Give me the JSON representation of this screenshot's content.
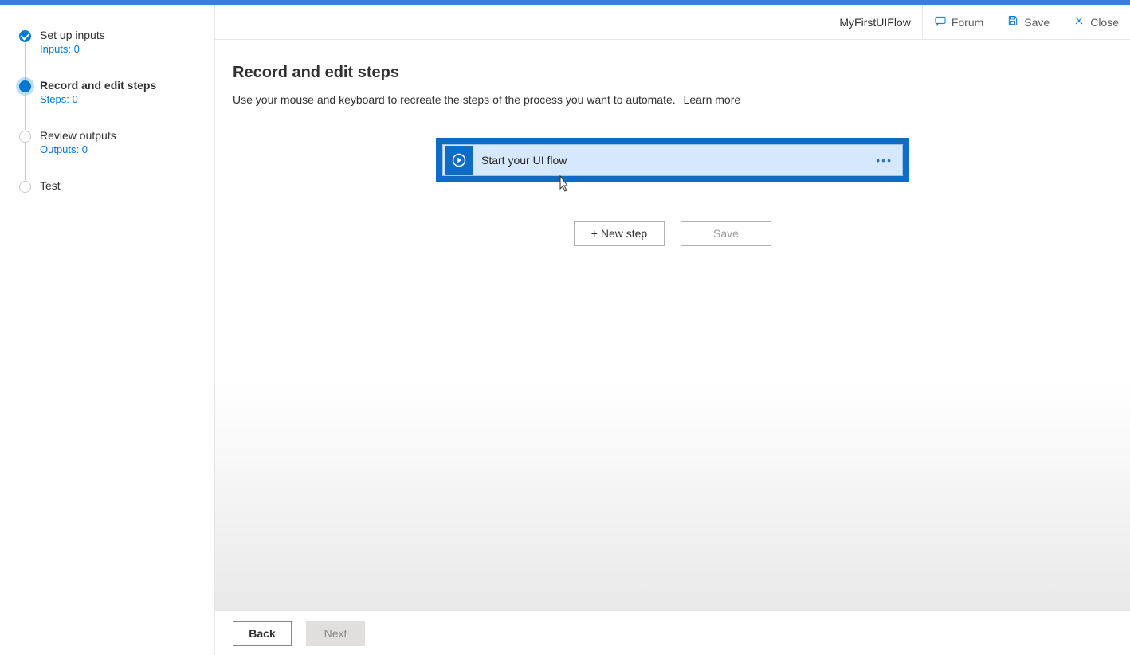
{
  "header": {
    "flowName": "MyFirstUIFlow",
    "forum": "Forum",
    "save": "Save",
    "close": "Close"
  },
  "sidebar": {
    "items": [
      {
        "title": "Set up inputs",
        "sub": "Inputs: 0",
        "state": "done"
      },
      {
        "title": "Record and edit steps",
        "sub": "Steps: 0",
        "state": "active"
      },
      {
        "title": "Review outputs",
        "sub": "Outputs: 0",
        "state": "pending"
      },
      {
        "title": "Test",
        "sub": "",
        "state": "pending"
      }
    ]
  },
  "page": {
    "title": "Record and edit steps",
    "description": "Use your mouse and keyboard to recreate the steps of the process you want to automate.",
    "learnMore": "Learn more"
  },
  "action": {
    "label": "Start your UI flow",
    "iconName": "play-circle-icon"
  },
  "buttons": {
    "newStep": "+ New step",
    "saveInline": "Save"
  },
  "footer": {
    "back": "Back",
    "next": "Next"
  }
}
